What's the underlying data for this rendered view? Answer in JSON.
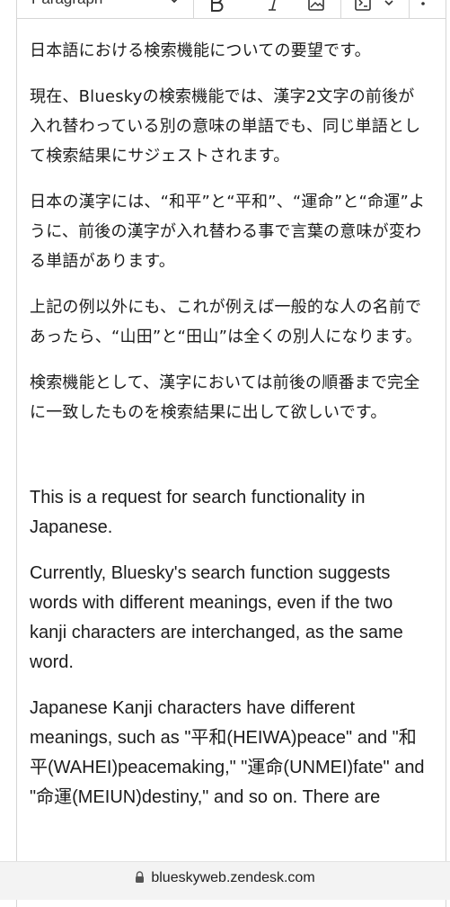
{
  "toolbar": {
    "format_label": "Paragraph",
    "icons": [
      "chevron-down-icon",
      "bold-icon",
      "italic-icon",
      "image-icon",
      "code-block-icon",
      "chevron-down-icon",
      "more-vertical-icon"
    ]
  },
  "content": {
    "japanese": [
      "日本語における検索機能についての要望です。",
      "現在、Blueskyの検索機能では、漢字2文字の前後が入れ替わっている別の意味の単語でも、同じ単語として検索結果にサジェストされます。",
      "日本の漢字には、“和平”と“平和”、“運命”と“命運”ように、前後の漢字が入れ替わる事で言葉の意味が変わる単語があります。",
      "上記の例以外にも、これが例えば一般的な人の名前であったら、“山田”と“田山”は全くの別人になります。",
      "検索機能として、漢字においては前後の順番まで完全に一致したものを検索結果に出して欲しいです。"
    ],
    "english": [
      "This is a request for search functionality in Japanese.",
      "Currently, Bluesky's search function suggests words with different meanings, even if the two kanji characters are interchanged, as the same word.",
      "Japanese Kanji characters have different meanings, such as \"平和(HEIWA)peace\" and \"和平(WAHEI)peacemaking,\" \"運命(UNMEI)fate\" and \"命運(MEIUN)destiny,\" and so on. There are"
    ]
  },
  "browser": {
    "url": "blueskyweb.zendesk.com",
    "lock_icon": "lock-icon"
  },
  "colors": {
    "border": "#d6d6d6",
    "text": "#1c1c1c",
    "bar_bg": "#f3f3f3"
  }
}
